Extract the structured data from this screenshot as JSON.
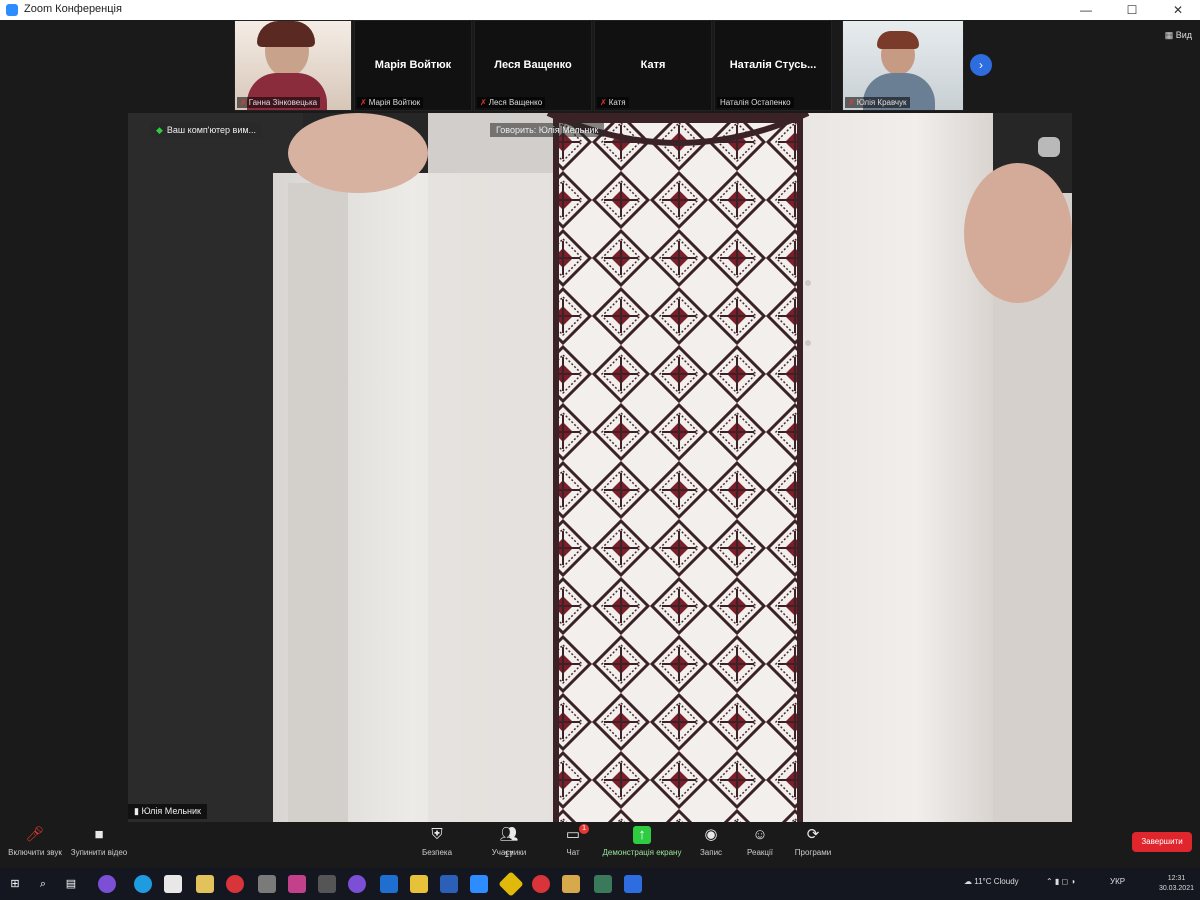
{
  "window": {
    "title": "Zoom Конференція",
    "minimize": "—",
    "maximize": "☐",
    "close": "✕"
  },
  "view": {
    "label": "Вид"
  },
  "participants": [
    {
      "name": "Ганна Зінковецька",
      "video": true,
      "muted": true
    },
    {
      "name": "Марія Войтюк",
      "big_name": "Марія Войтюк",
      "video": false,
      "muted": true
    },
    {
      "name": "Леся Ващенко",
      "big_name": "Леся Ващенко",
      "video": false,
      "muted": true
    },
    {
      "name": "Катя",
      "big_name": "Катя",
      "video": false,
      "muted": true
    },
    {
      "name": "Наталія Остапенко",
      "big_name": "Наталія Стусь...",
      "video": false,
      "muted": false
    },
    {
      "name": "Юлія Кравчук",
      "video": true,
      "muted": true
    }
  ],
  "next_page_icon": "chevron-right-icon",
  "main_video": {
    "top_label": "Ваш комп'ютер вим...",
    "talking": "Говорить: Юлія Мельник",
    "speaker_name": "Юлія Мельник"
  },
  "toolbar": {
    "mute": "Включити звук",
    "video": "Зупинити відео",
    "security": "Безпека",
    "participants": "Учасники",
    "participants_count": "17",
    "chat": "Чат",
    "chat_badge": "1",
    "share": "Демонстрація екрану",
    "record": "Запис",
    "reactions": "Реакції",
    "apps": "Програми",
    "end": "Завершити"
  },
  "taskbar": {
    "apps": [
      "windows-icon",
      "search-icon",
      "taskview-icon",
      "viber-icon",
      "edge-icon",
      "store-icon",
      "notes-icon",
      "opera-icon",
      "tools-icon",
      "office-icon",
      "settings-icon",
      "viber2-icon",
      "mail-icon",
      "files-icon",
      "word-icon",
      "zoom-icon",
      "binance-icon",
      "opera2-icon",
      "shield-icon",
      "pin-icon",
      "app-icon"
    ],
    "weather": "11°C Cloudy",
    "lang": "УКР",
    "time": "12:31",
    "date": "30.03.2021"
  },
  "colors": {
    "accent": "#2d8cff",
    "end": "#e0262d",
    "green": "#2ecc40"
  }
}
